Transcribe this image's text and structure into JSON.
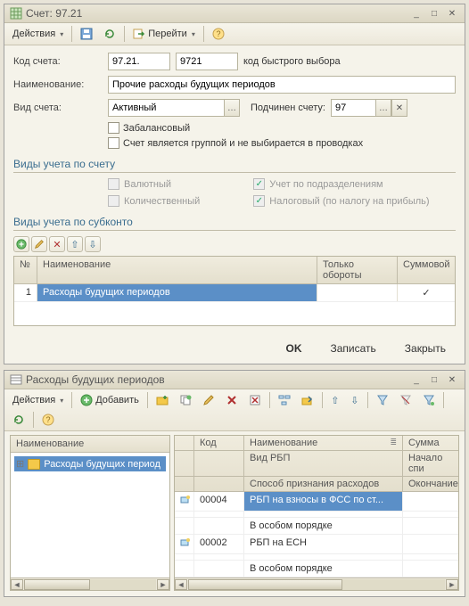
{
  "w1": {
    "title": "Счет: 97.21",
    "toolbar": {
      "actions": "Действия",
      "goto": "Перейти"
    },
    "form": {
      "code_label": "Код счета:",
      "code_value": "97.21.",
      "quick_code": "9721",
      "quick_code_label": "код быстрого выбора",
      "name_label": "Наименование:",
      "name_value": "Прочие расходы будущих периодов",
      "kind_label": "Вид счета:",
      "kind_value": "Активный",
      "parent_label": "Подчинен счету:",
      "parent_value": "97",
      "chk_offbalance": "Забалансовый",
      "chk_isgroup": "Счет является группой и не выбирается в проводках"
    },
    "section_acct": "Виды учета по счету",
    "checks": {
      "currency": "Валютный",
      "qty": "Количественный",
      "dept": "Учет по подразделениям",
      "tax": "Налоговый (по налогу на прибыль)"
    },
    "section_sub": "Виды учета по субконто",
    "grid": {
      "col_num": "№",
      "col_name": "Наименование",
      "col_turn": "Только обороты",
      "col_sum": "Суммовой",
      "row1_num": "1",
      "row1_name": "Расходы будущих периодов",
      "row1_sum": "✓"
    },
    "footer": {
      "ok": "OK",
      "save": "Записать",
      "close": "Закрыть"
    }
  },
  "w2": {
    "title": "Расходы будущих периодов",
    "toolbar": {
      "actions": "Действия",
      "add": "Добавить"
    },
    "tree": {
      "header": "Наименование",
      "node": "Расходы будущих период"
    },
    "rgrid": {
      "col_code": "Код",
      "col_name": "Наименование",
      "col_sum": "Сумма",
      "col_kind": "Вид РБП",
      "col_start": "Начало спи",
      "col_method": "Способ признания расходов",
      "col_end": "Окончание",
      "r1_code": "00004",
      "r1_name": "РБП на взносы в ФСС по ст...",
      "r1_method": "В особом порядке",
      "r2_code": "00002",
      "r2_name": "РБП на ЕСН",
      "r2_method": "В особом порядке"
    }
  }
}
